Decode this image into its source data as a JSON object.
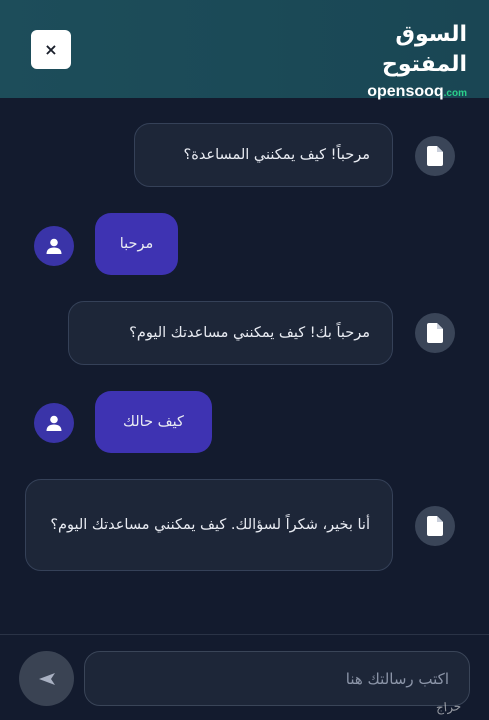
{
  "header": {
    "close_label": "×",
    "logo_arabic": "السوق المفتوح",
    "logo_english": "opensooq",
    "logo_english_suffix": ".com"
  },
  "messages": [
    {
      "sender": "bot",
      "text": "مرحباً! كيف يمكنني المساعدة؟",
      "icon": "document-icon"
    },
    {
      "sender": "user",
      "text": "مرحبا",
      "icon": "user-icon"
    },
    {
      "sender": "bot",
      "text": "مرحباً بك! كيف يمكنني مساعدتك اليوم؟",
      "icon": "document-icon"
    },
    {
      "sender": "user",
      "text": "كيف حالك",
      "icon": "user-icon"
    },
    {
      "sender": "bot",
      "text": "أنا بخير، شكراً لسؤالك. كيف يمكنني مساعدتك اليوم؟",
      "icon": "document-icon"
    }
  ],
  "composer": {
    "placeholder": "اكتب رسالتك هنا",
    "send_icon": "send-icon"
  },
  "watermark": "حراج",
  "colors": {
    "header": "#1b4a57",
    "background": "#131b2e",
    "bot_bubble": "#1d2638",
    "user_bubble": "#3e33b2",
    "user_avatar": "#3a34a8",
    "bot_avatar": "#3a4558"
  }
}
